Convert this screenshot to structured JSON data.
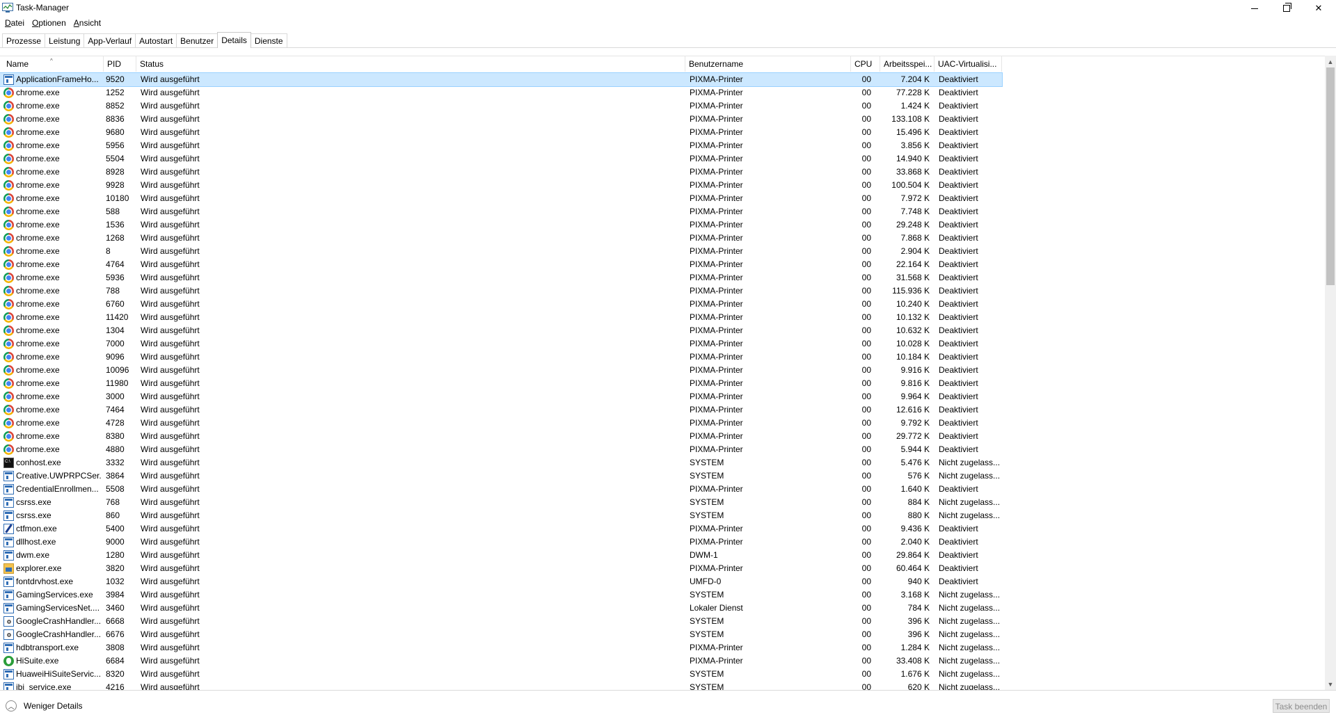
{
  "window": {
    "title": "Task-Manager"
  },
  "menu": [
    {
      "label": "Datei",
      "accel": "D",
      "rest": "atei"
    },
    {
      "label": "Optionen",
      "accel": "O",
      "rest": "ptionen"
    },
    {
      "label": "Ansicht",
      "accel": "A",
      "rest": "nsicht"
    }
  ],
  "tabs": [
    {
      "label": "Prozesse",
      "active": false
    },
    {
      "label": "Leistung",
      "active": false
    },
    {
      "label": "App-Verlauf",
      "active": false
    },
    {
      "label": "Autostart",
      "active": false
    },
    {
      "label": "Benutzer",
      "active": false
    },
    {
      "label": "Details",
      "active": true
    },
    {
      "label": "Dienste",
      "active": false
    }
  ],
  "columns": {
    "name": "Name",
    "pid": "PID",
    "status": "Status",
    "user": "Benutzername",
    "cpu": "CPU",
    "mem": "Arbeitsspei...",
    "uac": "UAC-Virtualisi..."
  },
  "sort": {
    "column": "name",
    "indicator": "^"
  },
  "rows": [
    {
      "icon": "window",
      "name": "ApplicationFrameHo...",
      "pid": "9520",
      "status": "Wird ausgeführt",
      "user": "PIXMA-Printer",
      "cpu": "00",
      "mem": "7.204 K",
      "uac": "Deaktiviert",
      "selected": true
    },
    {
      "icon": "chrome",
      "name": "chrome.exe",
      "pid": "1252",
      "status": "Wird ausgeführt",
      "user": "PIXMA-Printer",
      "cpu": "00",
      "mem": "77.228 K",
      "uac": "Deaktiviert"
    },
    {
      "icon": "chrome",
      "name": "chrome.exe",
      "pid": "8852",
      "status": "Wird ausgeführt",
      "user": "PIXMA-Printer",
      "cpu": "00",
      "mem": "1.424 K",
      "uac": "Deaktiviert"
    },
    {
      "icon": "chrome",
      "name": "chrome.exe",
      "pid": "8836",
      "status": "Wird ausgeführt",
      "user": "PIXMA-Printer",
      "cpu": "00",
      "mem": "133.108 K",
      "uac": "Deaktiviert"
    },
    {
      "icon": "chrome",
      "name": "chrome.exe",
      "pid": "9680",
      "status": "Wird ausgeführt",
      "user": "PIXMA-Printer",
      "cpu": "00",
      "mem": "15.496 K",
      "uac": "Deaktiviert"
    },
    {
      "icon": "chrome",
      "name": "chrome.exe",
      "pid": "5956",
      "status": "Wird ausgeführt",
      "user": "PIXMA-Printer",
      "cpu": "00",
      "mem": "3.856 K",
      "uac": "Deaktiviert"
    },
    {
      "icon": "chrome",
      "name": "chrome.exe",
      "pid": "5504",
      "status": "Wird ausgeführt",
      "user": "PIXMA-Printer",
      "cpu": "00",
      "mem": "14.940 K",
      "uac": "Deaktiviert"
    },
    {
      "icon": "chrome",
      "name": "chrome.exe",
      "pid": "8928",
      "status": "Wird ausgeführt",
      "user": "PIXMA-Printer",
      "cpu": "00",
      "mem": "33.868 K",
      "uac": "Deaktiviert"
    },
    {
      "icon": "chrome",
      "name": "chrome.exe",
      "pid": "9928",
      "status": "Wird ausgeführt",
      "user": "PIXMA-Printer",
      "cpu": "00",
      "mem": "100.504 K",
      "uac": "Deaktiviert"
    },
    {
      "icon": "chrome",
      "name": "chrome.exe",
      "pid": "10180",
      "status": "Wird ausgeführt",
      "user": "PIXMA-Printer",
      "cpu": "00",
      "mem": "7.972 K",
      "uac": "Deaktiviert"
    },
    {
      "icon": "chrome",
      "name": "chrome.exe",
      "pid": "588",
      "status": "Wird ausgeführt",
      "user": "PIXMA-Printer",
      "cpu": "00",
      "mem": "7.748 K",
      "uac": "Deaktiviert"
    },
    {
      "icon": "chrome",
      "name": "chrome.exe",
      "pid": "1536",
      "status": "Wird ausgeführt",
      "user": "PIXMA-Printer",
      "cpu": "00",
      "mem": "29.248 K",
      "uac": "Deaktiviert"
    },
    {
      "icon": "chrome",
      "name": "chrome.exe",
      "pid": "1268",
      "status": "Wird ausgeführt",
      "user": "PIXMA-Printer",
      "cpu": "00",
      "mem": "7.868 K",
      "uac": "Deaktiviert"
    },
    {
      "icon": "chrome",
      "name": "chrome.exe",
      "pid": "8",
      "status": "Wird ausgeführt",
      "user": "PIXMA-Printer",
      "cpu": "00",
      "mem": "2.904 K",
      "uac": "Deaktiviert"
    },
    {
      "icon": "chrome",
      "name": "chrome.exe",
      "pid": "4764",
      "status": "Wird ausgeführt",
      "user": "PIXMA-Printer",
      "cpu": "00",
      "mem": "22.164 K",
      "uac": "Deaktiviert"
    },
    {
      "icon": "chrome",
      "name": "chrome.exe",
      "pid": "5936",
      "status": "Wird ausgeführt",
      "user": "PIXMA-Printer",
      "cpu": "00",
      "mem": "31.568 K",
      "uac": "Deaktiviert"
    },
    {
      "icon": "chrome",
      "name": "chrome.exe",
      "pid": "788",
      "status": "Wird ausgeführt",
      "user": "PIXMA-Printer",
      "cpu": "00",
      "mem": "115.936 K",
      "uac": "Deaktiviert"
    },
    {
      "icon": "chrome",
      "name": "chrome.exe",
      "pid": "6760",
      "status": "Wird ausgeführt",
      "user": "PIXMA-Printer",
      "cpu": "00",
      "mem": "10.240 K",
      "uac": "Deaktiviert"
    },
    {
      "icon": "chrome",
      "name": "chrome.exe",
      "pid": "11420",
      "status": "Wird ausgeführt",
      "user": "PIXMA-Printer",
      "cpu": "00",
      "mem": "10.132 K",
      "uac": "Deaktiviert"
    },
    {
      "icon": "chrome",
      "name": "chrome.exe",
      "pid": "1304",
      "status": "Wird ausgeführt",
      "user": "PIXMA-Printer",
      "cpu": "00",
      "mem": "10.632 K",
      "uac": "Deaktiviert"
    },
    {
      "icon": "chrome",
      "name": "chrome.exe",
      "pid": "7000",
      "status": "Wird ausgeführt",
      "user": "PIXMA-Printer",
      "cpu": "00",
      "mem": "10.028 K",
      "uac": "Deaktiviert"
    },
    {
      "icon": "chrome",
      "name": "chrome.exe",
      "pid": "9096",
      "status": "Wird ausgeführt",
      "user": "PIXMA-Printer",
      "cpu": "00",
      "mem": "10.184 K",
      "uac": "Deaktiviert"
    },
    {
      "icon": "chrome",
      "name": "chrome.exe",
      "pid": "10096",
      "status": "Wird ausgeführt",
      "user": "PIXMA-Printer",
      "cpu": "00",
      "mem": "9.916 K",
      "uac": "Deaktiviert"
    },
    {
      "icon": "chrome",
      "name": "chrome.exe",
      "pid": "11980",
      "status": "Wird ausgeführt",
      "user": "PIXMA-Printer",
      "cpu": "00",
      "mem": "9.816 K",
      "uac": "Deaktiviert"
    },
    {
      "icon": "chrome",
      "name": "chrome.exe",
      "pid": "3000",
      "status": "Wird ausgeführt",
      "user": "PIXMA-Printer",
      "cpu": "00",
      "mem": "9.964 K",
      "uac": "Deaktiviert"
    },
    {
      "icon": "chrome",
      "name": "chrome.exe",
      "pid": "7464",
      "status": "Wird ausgeführt",
      "user": "PIXMA-Printer",
      "cpu": "00",
      "mem": "12.616 K",
      "uac": "Deaktiviert"
    },
    {
      "icon": "chrome",
      "name": "chrome.exe",
      "pid": "4728",
      "status": "Wird ausgeführt",
      "user": "PIXMA-Printer",
      "cpu": "00",
      "mem": "9.792 K",
      "uac": "Deaktiviert"
    },
    {
      "icon": "chrome",
      "name": "chrome.exe",
      "pid": "8380",
      "status": "Wird ausgeführt",
      "user": "PIXMA-Printer",
      "cpu": "00",
      "mem": "29.772 K",
      "uac": "Deaktiviert"
    },
    {
      "icon": "chrome",
      "name": "chrome.exe",
      "pid": "4880",
      "status": "Wird ausgeführt",
      "user": "PIXMA-Printer",
      "cpu": "00",
      "mem": "5.944 K",
      "uac": "Deaktiviert"
    },
    {
      "icon": "console",
      "name": "conhost.exe",
      "pid": "3332",
      "status": "Wird ausgeführt",
      "user": "SYSTEM",
      "cpu": "00",
      "mem": "5.476 K",
      "uac": "Nicht zugelass..."
    },
    {
      "icon": "window",
      "name": "Creative.UWPRPCSer...",
      "pid": "3864",
      "status": "Wird ausgeführt",
      "user": "SYSTEM",
      "cpu": "00",
      "mem": "576 K",
      "uac": "Nicht zugelass..."
    },
    {
      "icon": "window",
      "name": "CredentialEnrollmen...",
      "pid": "5508",
      "status": "Wird ausgeführt",
      "user": "PIXMA-Printer",
      "cpu": "00",
      "mem": "1.640 K",
      "uac": "Deaktiviert"
    },
    {
      "icon": "window",
      "name": "csrss.exe",
      "pid": "768",
      "status": "Wird ausgeführt",
      "user": "SYSTEM",
      "cpu": "00",
      "mem": "884 K",
      "uac": "Nicht zugelass..."
    },
    {
      "icon": "window",
      "name": "csrss.exe",
      "pid": "860",
      "status": "Wird ausgeführt",
      "user": "SYSTEM",
      "cpu": "00",
      "mem": "880 K",
      "uac": "Nicht zugelass..."
    },
    {
      "icon": "pen",
      "name": "ctfmon.exe",
      "pid": "5400",
      "status": "Wird ausgeführt",
      "user": "PIXMA-Printer",
      "cpu": "00",
      "mem": "9.436 K",
      "uac": "Deaktiviert"
    },
    {
      "icon": "window",
      "name": "dllhost.exe",
      "pid": "9000",
      "status": "Wird ausgeführt",
      "user": "PIXMA-Printer",
      "cpu": "00",
      "mem": "2.040 K",
      "uac": "Deaktiviert"
    },
    {
      "icon": "window",
      "name": "dwm.exe",
      "pid": "1280",
      "status": "Wird ausgeführt",
      "user": "DWM-1",
      "cpu": "00",
      "mem": "29.864 K",
      "uac": "Deaktiviert"
    },
    {
      "icon": "folder",
      "name": "explorer.exe",
      "pid": "3820",
      "status": "Wird ausgeführt",
      "user": "PIXMA-Printer",
      "cpu": "00",
      "mem": "60.464 K",
      "uac": "Deaktiviert"
    },
    {
      "icon": "window",
      "name": "fontdrvhost.exe",
      "pid": "1032",
      "status": "Wird ausgeführt",
      "user": "UMFD-0",
      "cpu": "00",
      "mem": "940 K",
      "uac": "Deaktiviert"
    },
    {
      "icon": "window",
      "name": "GamingServices.exe",
      "pid": "3984",
      "status": "Wird ausgeführt",
      "user": "SYSTEM",
      "cpu": "00",
      "mem": "3.168 K",
      "uac": "Nicht zugelass..."
    },
    {
      "icon": "window",
      "name": "GamingServicesNet....",
      "pid": "3460",
      "status": "Wird ausgeführt",
      "user": "Lokaler Dienst",
      "cpu": "00",
      "mem": "784 K",
      "uac": "Nicht zugelass..."
    },
    {
      "icon": "gear",
      "name": "GoogleCrashHandler...",
      "pid": "6668",
      "status": "Wird ausgeführt",
      "user": "SYSTEM",
      "cpu": "00",
      "mem": "396 K",
      "uac": "Nicht zugelass..."
    },
    {
      "icon": "gear",
      "name": "GoogleCrashHandler...",
      "pid": "6676",
      "status": "Wird ausgeführt",
      "user": "SYSTEM",
      "cpu": "00",
      "mem": "396 K",
      "uac": "Nicht zugelass..."
    },
    {
      "icon": "window",
      "name": "hdbtransport.exe",
      "pid": "3808",
      "status": "Wird ausgeführt",
      "user": "PIXMA-Printer",
      "cpu": "00",
      "mem": "1.284 K",
      "uac": "Nicht zugelass..."
    },
    {
      "icon": "hisuite",
      "name": "HiSuite.exe",
      "pid": "6684",
      "status": "Wird ausgeführt",
      "user": "PIXMA-Printer",
      "cpu": "00",
      "mem": "33.408 K",
      "uac": "Nicht zugelass..."
    },
    {
      "icon": "window",
      "name": "HuaweiHiSuiteServic...",
      "pid": "8320",
      "status": "Wird ausgeführt",
      "user": "SYSTEM",
      "cpu": "00",
      "mem": "1.676 K",
      "uac": "Nicht zugelass..."
    },
    {
      "icon": "window",
      "name": "ibi_service.exe",
      "pid": "4216",
      "status": "Wird ausgeführt",
      "user": "SYSTEM",
      "cpu": "00",
      "mem": "620 K",
      "uac": "Nicht zugelass..."
    }
  ],
  "footer": {
    "fewer_details": "Weniger Details",
    "end_task": "Task beenden"
  }
}
